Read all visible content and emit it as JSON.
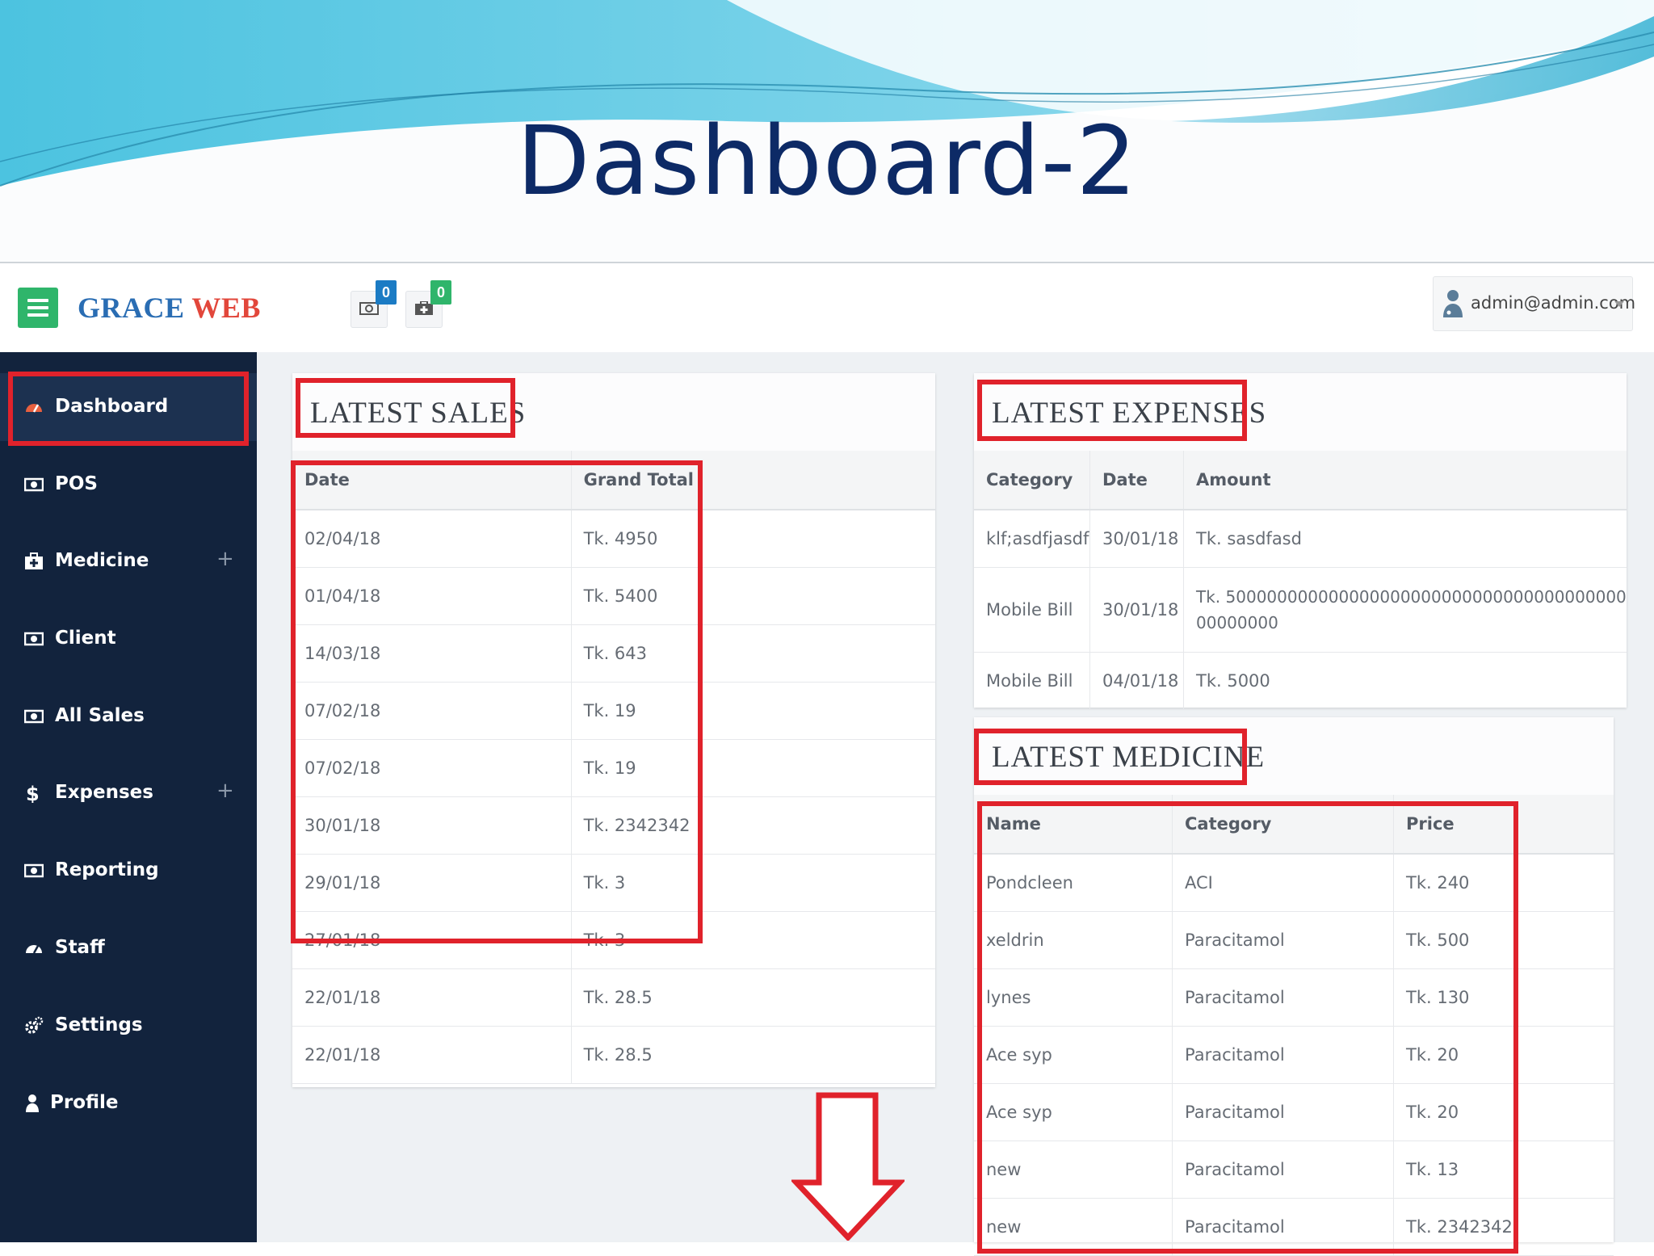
{
  "slide": {
    "title": "Dashboard-2"
  },
  "brand": {
    "part1": "GRACE",
    "part2": "WEB"
  },
  "notifications": [
    {
      "icon": "money-icon",
      "count": "0",
      "color": "#1b7bc4"
    },
    {
      "icon": "medkit-icon",
      "count": "0",
      "color": "#2fb56b"
    }
  ],
  "user": {
    "email": "admin@admin.com"
  },
  "sidebar": {
    "items": [
      {
        "label": "Dashboard",
        "icon": "dashboard-icon",
        "active": true
      },
      {
        "label": "POS",
        "icon": "money-icon"
      },
      {
        "label": "Medicine",
        "icon": "medkit-icon",
        "expand": "+"
      },
      {
        "label": "Client",
        "icon": "money-icon"
      },
      {
        "label": "All Sales",
        "icon": "money-icon"
      },
      {
        "label": "Expenses",
        "icon": "dollar-icon",
        "expand": "+"
      },
      {
        "label": "Reporting",
        "icon": "money-icon"
      },
      {
        "label": "Staff",
        "icon": "dashboard-icon"
      },
      {
        "label": "Settings",
        "icon": "gears-icon"
      },
      {
        "label": "Profile",
        "icon": "user-icon"
      }
    ]
  },
  "latest_sales": {
    "title": "LATEST SALES",
    "columns": [
      "Date",
      "Grand Total"
    ],
    "rows": [
      [
        "02/04/18",
        "Tk. 4950"
      ],
      [
        "01/04/18",
        "Tk. 5400"
      ],
      [
        "14/03/18",
        "Tk. 643"
      ],
      [
        "07/02/18",
        "Tk. 19"
      ],
      [
        "07/02/18",
        "Tk. 19"
      ],
      [
        "30/01/18",
        "Tk. 2342342"
      ],
      [
        "29/01/18",
        "Tk. 3"
      ],
      [
        "27/01/18",
        "Tk. 3"
      ],
      [
        "22/01/18",
        "Tk. 28.5"
      ],
      [
        "22/01/18",
        "Tk. 28.5"
      ]
    ]
  },
  "latest_expenses": {
    "title": "LATEST EXPENSES",
    "columns": [
      "Category",
      "Date",
      "Amount"
    ],
    "rows": [
      [
        "klf;asdfjasdf",
        "30/01/18",
        "Tk. sasdfasd"
      ],
      [
        "Mobile Bill",
        "30/01/18",
        "Tk. 50000000000000000000000000000000000000000000000"
      ],
      [
        "Mobile Bill",
        "04/01/18",
        "Tk. 5000"
      ]
    ]
  },
  "latest_medicine": {
    "title": "LATEST MEDICINE",
    "columns": [
      "Name",
      "Category",
      "Price"
    ],
    "rows": [
      [
        "Pondcleen",
        "ACI",
        "Tk. 240"
      ],
      [
        "xeldrin",
        "Paracitamol",
        "Tk. 500"
      ],
      [
        "lynes",
        "Paracitamol",
        "Tk. 130"
      ],
      [
        "Ace syp",
        "Paracitamol",
        "Tk. 20"
      ],
      [
        "Ace syp",
        "Paracitamol",
        "Tk. 20"
      ],
      [
        "new",
        "Paracitamol",
        "Tk. 13"
      ],
      [
        "new",
        "Paracitamol",
        "Tk. 2342342"
      ]
    ]
  },
  "colors": {
    "highlight": "#e0222b",
    "sidebar": "#12233d",
    "accent_green": "#2fb56b",
    "title": "#0d2a66"
  }
}
